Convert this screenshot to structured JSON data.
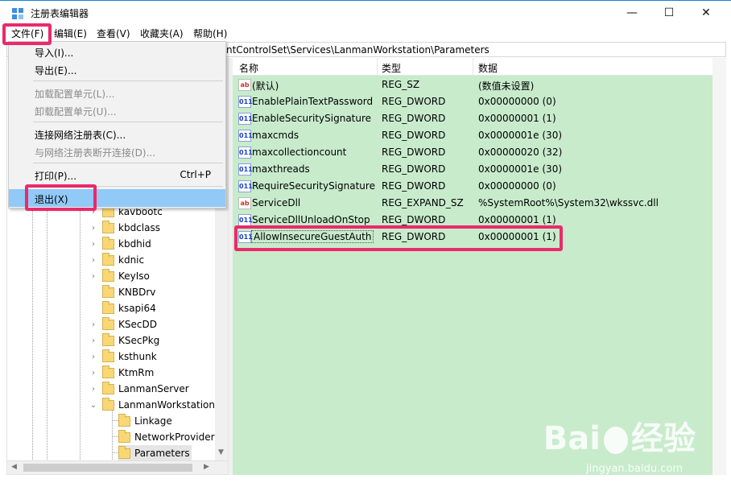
{
  "window": {
    "title": "注册表编辑器"
  },
  "controls": {
    "minimize": "—",
    "maximize": "☐",
    "close": "✕"
  },
  "menubar": {
    "items": [
      {
        "label": "文件(F)"
      },
      {
        "label": "编辑(E)"
      },
      {
        "label": "查看(V)"
      },
      {
        "label": "收藏夹(A)"
      },
      {
        "label": "帮助(H)"
      }
    ]
  },
  "address": {
    "path_visible": "ntControlSet\\Services\\LanmanWorkstation\\Parameters"
  },
  "file_menu": {
    "items": [
      {
        "label": "导入(I)...",
        "enabled": true
      },
      {
        "label": "导出(E)...",
        "enabled": true
      },
      {
        "label": "加载配置单元(L)...",
        "enabled": false
      },
      {
        "label": "卸载配置单元(U)...",
        "enabled": false
      },
      {
        "label": "连接网络注册表(C)...",
        "enabled": true
      },
      {
        "label": "与网络注册表断开连接(D)...",
        "enabled": false
      },
      {
        "label": "打印(P)...",
        "enabled": true,
        "shortcut": "Ctrl+P"
      },
      {
        "label": "退出(X)",
        "enabled": true,
        "highlighted": true
      }
    ]
  },
  "tree": {
    "items": [
      {
        "label": "kavbootc"
      },
      {
        "label": "kbdclass"
      },
      {
        "label": "kbdhid"
      },
      {
        "label": "kdnic"
      },
      {
        "label": "KeyIso"
      },
      {
        "label": "KNBDrv"
      },
      {
        "label": "ksapi64"
      },
      {
        "label": "KSecDD"
      },
      {
        "label": "KSecPkg"
      },
      {
        "label": "ksthunk"
      },
      {
        "label": "KtmRm"
      },
      {
        "label": "LanmanServer"
      },
      {
        "label": "LanmanWorkstation"
      },
      {
        "label": "Linkage"
      },
      {
        "label": "NetworkProvider"
      },
      {
        "label": "Parameters"
      }
    ]
  },
  "list": {
    "headers": {
      "name": "名称",
      "type": "类型",
      "data": "数据"
    },
    "rows": [
      {
        "icon": "ab",
        "name": "(默认)",
        "type": "REG_SZ",
        "data": "(数值未设置)"
      },
      {
        "icon": "dword",
        "name": "EnablePlainTextPassword",
        "type": "REG_DWORD",
        "data": "0x00000000 (0)"
      },
      {
        "icon": "dword",
        "name": "EnableSecuritySignature",
        "type": "REG_DWORD",
        "data": "0x00000001 (1)"
      },
      {
        "icon": "dword",
        "name": "maxcmds",
        "type": "REG_DWORD",
        "data": "0x0000001e (30)"
      },
      {
        "icon": "dword",
        "name": "maxcollectioncount",
        "type": "REG_DWORD",
        "data": "0x00000020 (32)"
      },
      {
        "icon": "dword",
        "name": "maxthreads",
        "type": "REG_DWORD",
        "data": "0x0000001e (30)"
      },
      {
        "icon": "dword",
        "name": "RequireSecuritySignature",
        "type": "REG_DWORD",
        "data": "0x00000000 (0)"
      },
      {
        "icon": "ab",
        "name": "ServiceDll",
        "type": "REG_EXPAND_SZ",
        "data": "%SystemRoot%\\System32\\wkssvc.dll"
      },
      {
        "icon": "dword",
        "name": "ServiceDllUnloadOnStop",
        "type": "REG_DWORD",
        "data": "0x00000001 (1)"
      },
      {
        "icon": "dword",
        "name": "AllowInsecureGuestAuth",
        "type": "REG_DWORD",
        "data": "0x00000001 (1)"
      }
    ]
  },
  "colors": {
    "accent_highlight": "#ea2a6a",
    "list_bg": "#c8ebcc",
    "menu_hover": "#91c9f7"
  },
  "watermark": {
    "brand_a": "Bai",
    "brand_b": "经验",
    "url": "jingyan.baidu.com"
  }
}
